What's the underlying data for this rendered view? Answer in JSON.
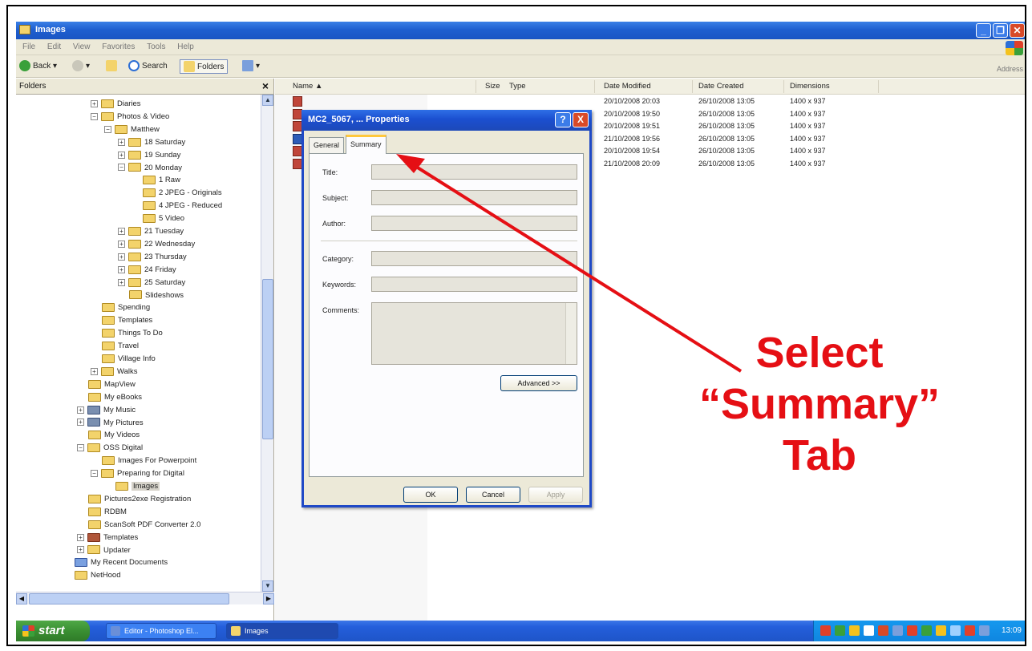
{
  "window": {
    "title": "Images"
  },
  "menubar": {
    "items": [
      "File",
      "Edit",
      "View",
      "Favorites",
      "Tools",
      "Help"
    ]
  },
  "toolbar": {
    "back": "Back",
    "search": "Search",
    "folders": "Folders",
    "address": "Address"
  },
  "folders_pane": {
    "title": "Folders",
    "items": [
      {
        "label": "Diaries",
        "level": 3,
        "pm": "+"
      },
      {
        "label": "Photos & Video",
        "level": 3,
        "pm": "-"
      },
      {
        "label": "Matthew",
        "level": 4,
        "pm": "-"
      },
      {
        "label": "18 Saturday",
        "level": 5,
        "pm": "+"
      },
      {
        "label": "19 Sunday",
        "level": 5,
        "pm": "+"
      },
      {
        "label": "20 Monday",
        "level": 5,
        "pm": "-"
      },
      {
        "label": "1 Raw",
        "level": 6,
        "pm": ""
      },
      {
        "label": "2 JPEG - Originals",
        "level": 6,
        "pm": ""
      },
      {
        "label": "4 JPEG - Reduced",
        "level": 6,
        "pm": ""
      },
      {
        "label": "5 Video",
        "level": 6,
        "pm": ""
      },
      {
        "label": "21 Tuesday",
        "level": 5,
        "pm": "+"
      },
      {
        "label": "22 Wednesday",
        "level": 5,
        "pm": "+"
      },
      {
        "label": "23 Thursday",
        "level": 5,
        "pm": "+"
      },
      {
        "label": "24 Friday",
        "level": 5,
        "pm": "+"
      },
      {
        "label": "25 Saturday",
        "level": 5,
        "pm": "+"
      },
      {
        "label": "Slideshows",
        "level": 5,
        "pm": ""
      },
      {
        "label": "Spending",
        "level": 3,
        "pm": ""
      },
      {
        "label": "Templates",
        "level": 3,
        "pm": ""
      },
      {
        "label": "Things To Do",
        "level": 3,
        "pm": ""
      },
      {
        "label": "Travel",
        "level": 3,
        "pm": ""
      },
      {
        "label": "Village Info",
        "level": 3,
        "pm": ""
      },
      {
        "label": "Walks",
        "level": 3,
        "pm": "+"
      },
      {
        "label": "MapView",
        "level": 2,
        "pm": ""
      },
      {
        "label": "My eBooks",
        "level": 2,
        "pm": ""
      },
      {
        "label": "My Music",
        "level": 2,
        "pm": "+"
      },
      {
        "label": "My Pictures",
        "level": 2,
        "pm": "+"
      },
      {
        "label": "My Videos",
        "level": 2,
        "pm": ""
      },
      {
        "label": "OSS Digital",
        "level": 2,
        "pm": "-"
      },
      {
        "label": "Images For Powerpoint",
        "level": 3,
        "pm": ""
      },
      {
        "label": "Preparing for Digital",
        "level": 3,
        "pm": "-"
      },
      {
        "label": "Images",
        "level": 4,
        "pm": "",
        "selected": true
      },
      {
        "label": "Pictures2exe Registration",
        "level": 2,
        "pm": ""
      },
      {
        "label": "RDBM",
        "level": 2,
        "pm": ""
      },
      {
        "label": "ScanSoft PDF Converter 2.0",
        "level": 2,
        "pm": ""
      },
      {
        "label": "Templates",
        "level": 2,
        "pm": "+"
      },
      {
        "label": "Updater",
        "level": 2,
        "pm": "+"
      },
      {
        "label": "My Recent Documents",
        "level": 1,
        "pm": ""
      },
      {
        "label": "NetHood",
        "level": 1,
        "pm": ""
      }
    ]
  },
  "file_list": {
    "columns": [
      "Name",
      "Size",
      "Type",
      "Date Modified",
      "Date Created",
      "Dimensions"
    ],
    "rows": [
      {
        "date_modified": "20/10/2008 20:03",
        "date_created": "26/10/2008 13:05",
        "dimensions": "1400 x 937"
      },
      {
        "date_modified": "20/10/2008 19:50",
        "date_created": "26/10/2008 13:05",
        "dimensions": "1400 x 937"
      },
      {
        "date_modified": "20/10/2008 19:51",
        "date_created": "26/10/2008 13:05",
        "dimensions": "1400 x 937"
      },
      {
        "date_modified": "21/10/2008 19:56",
        "date_created": "26/10/2008 13:05",
        "dimensions": "1400 x 937"
      },
      {
        "date_modified": "20/10/2008 19:54",
        "date_created": "26/10/2008 13:05",
        "dimensions": "1400 x 937"
      },
      {
        "date_modified": "21/10/2008 20:09",
        "date_created": "26/10/2008 13:05",
        "dimensions": "1400 x 937"
      }
    ]
  },
  "dialog": {
    "title": "MC2_5067, ... Properties",
    "help": "?",
    "close": "X",
    "tabs": [
      "General",
      "Summary"
    ],
    "active_tab": "Summary",
    "fields": [
      {
        "label": "Title:",
        "value": ""
      },
      {
        "label": "Subject:",
        "value": ""
      },
      {
        "label": "Author:",
        "value": ""
      },
      {
        "label": "Category:",
        "value": ""
      },
      {
        "label": "Keywords:",
        "value": ""
      },
      {
        "label": "Comments:",
        "value": ""
      }
    ],
    "advanced_button": "Advanced >>",
    "ok": "OK",
    "cancel": "Cancel",
    "apply": "Apply"
  },
  "taskbar": {
    "start": "start",
    "tasks": [
      "Editor - Photoshop El...",
      "Images"
    ],
    "clock": "13:09"
  },
  "annotation": {
    "line1": "Select",
    "line2": "“Summary”",
    "line3": "Tab",
    "color": "#e50f14"
  }
}
